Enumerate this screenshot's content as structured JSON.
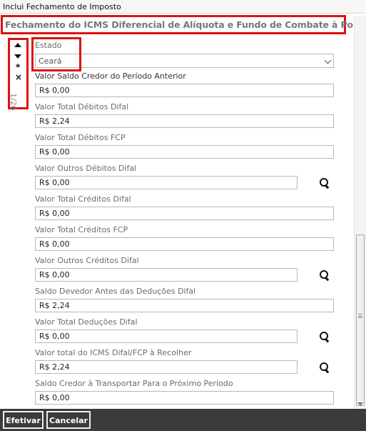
{
  "window": {
    "title": "Inclui Fechamento de Imposto"
  },
  "header": {
    "title": "Fechamento do ICMS Diferencial de Alíquota e Fundo de Combate à Pobreza"
  },
  "nav": {
    "counter": "1/26"
  },
  "estado": {
    "label": "Estado",
    "value": "Ceará"
  },
  "fields": [
    {
      "label": "Valor Saldo Credor do Período Anterior",
      "value": "R$ 0,00"
    },
    {
      "label": "Valor Total Débitos Difal",
      "value": "R$ 2,24"
    },
    {
      "label": "Valor Total Débitos FCP",
      "value": "R$ 0,00"
    },
    {
      "label": "Valor Outros Débitos Difal",
      "value": "R$ 0,00"
    },
    {
      "label": "Valor Total Créditos Difal",
      "value": "R$ 0,00"
    },
    {
      "label": "Valor Total Créditos FCP",
      "value": "R$ 0,00"
    },
    {
      "label": "Valor Outros Créditos Difal",
      "value": "R$ 0,00"
    },
    {
      "label": "Saldo Devedor Antes das Deduções Difal",
      "value": "R$ 2,24"
    },
    {
      "label": "Valor Total Deduções Difal",
      "value": "R$ 0,00"
    },
    {
      "label": "Valor total do ICMS Difal/FCP à Recolher",
      "value": "R$ 2,24"
    },
    {
      "label": "Saldo Credor à Transportar Para o Próximo Período",
      "value": "R$ 0,00"
    }
  ],
  "footer": {
    "confirm_label": "Efetivar",
    "cancel_label": "Cancelar"
  },
  "colors": {
    "highlight_border": "#dd1111",
    "footer_bg": "#3b3b3b"
  }
}
